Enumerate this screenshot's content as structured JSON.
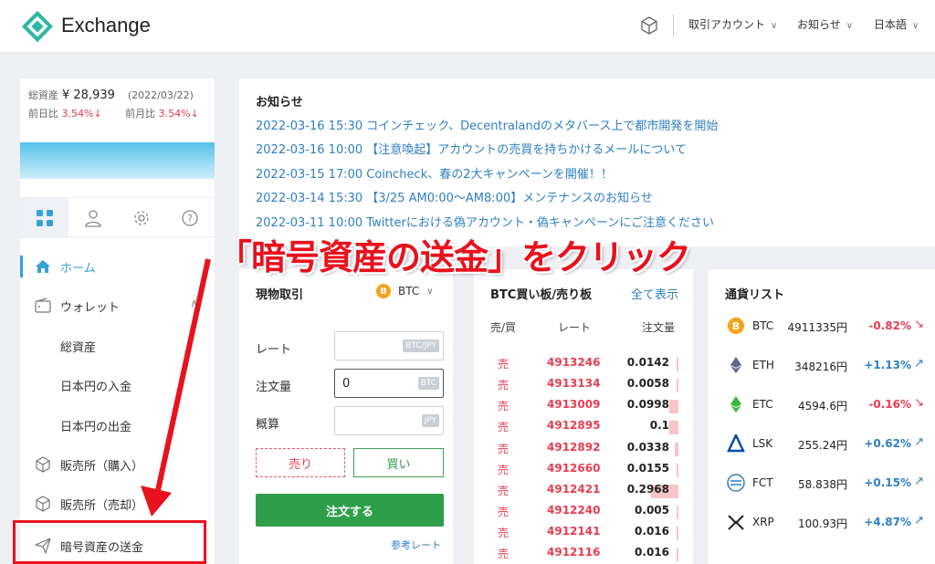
{
  "header": {
    "brand": "Exchange",
    "menu": [
      {
        "label": "取引アカウント"
      },
      {
        "label": "お知らせ"
      },
      {
        "label": "日本語"
      }
    ]
  },
  "sidebar": {
    "assets": {
      "label": "総資産",
      "value": "¥ 28,939",
      "date": "(2022/03/22)"
    },
    "changes": [
      {
        "label": "前日比",
        "value": "3.54%↓"
      },
      {
        "label": "前月比",
        "value": "3.54%↓"
      }
    ],
    "tabs": [
      {
        "icon": "grid-icon"
      },
      {
        "icon": "user-icon"
      },
      {
        "icon": "gear-icon"
      },
      {
        "icon": "help-icon"
      }
    ],
    "nav": [
      {
        "label": "ホーム",
        "icon": "home-icon",
        "active": true
      },
      {
        "label": "ウォレット",
        "icon": "wallet-icon"
      },
      {
        "label": "総資産"
      },
      {
        "label": "日本円の入金"
      },
      {
        "label": "日本円の出金"
      },
      {
        "label": "販売所（購入）",
        "icon": "box-icon"
      },
      {
        "label": "販売所（売却）",
        "icon": "box-icon"
      },
      {
        "label": "暗号資産の送金",
        "icon": "send-icon"
      }
    ]
  },
  "annotation": {
    "text": "「暗号資産の送金」をクリック",
    "color": "#e8121e"
  },
  "notices": {
    "title": "お知らせ",
    "items": [
      "2022-03-16 15:30 コインチェック、Decentralandのメタバース上で都市開発を開始",
      "2022-03-16 10:00 【注意喚起】アカウントの売買を持ちかけるメールについて",
      "2022-03-15 17:00 Coincheck、春の2大キャンペーンを開催！！",
      "2022-03-14 15:30 【3/25 AM0:00〜AM8:00】メンテナンスのお知らせ",
      "2022-03-11 10:00 Twitterにおける偽アカウント・偽キャンペーンにご注意ください"
    ]
  },
  "trade": {
    "title": "現物取引",
    "coin": "BTC",
    "coin_glyph": "B",
    "rate_label": "レート",
    "rate_unit": "BTC/JPY",
    "qty_label": "注文量",
    "qty_value": "0",
    "qty_unit": "BTC",
    "est_label": "概算",
    "est_unit": "JPY",
    "sell": "売り",
    "buy": "買い",
    "order": "注文する",
    "ref": "参考レート"
  },
  "book": {
    "title": "BTC買い板/売り板",
    "all": "全て表示",
    "headers": [
      "売/買",
      "レート",
      "注文量"
    ],
    "rows": [
      {
        "side": "売",
        "rate": "4913246",
        "qty": "0.0142",
        "fill": 0.03
      },
      {
        "side": "売",
        "rate": "4913134",
        "qty": "0.0058",
        "fill": 0.02
      },
      {
        "side": "売",
        "rate": "4913009",
        "qty": "0.0998",
        "fill": 0.2
      },
      {
        "side": "売",
        "rate": "4912895",
        "qty": "0.1",
        "fill": 0.2
      },
      {
        "side": "売",
        "rate": "4912892",
        "qty": "0.0338",
        "fill": 0.07
      },
      {
        "side": "売",
        "rate": "4912660",
        "qty": "0.0155",
        "fill": 0.03
      },
      {
        "side": "売",
        "rate": "4912421",
        "qty": "0.2968",
        "fill": 0.6
      },
      {
        "side": "売",
        "rate": "4912240",
        "qty": "0.005",
        "fill": 0.01
      },
      {
        "side": "売",
        "rate": "4912141",
        "qty": "0.016",
        "fill": 0.03
      },
      {
        "side": "売",
        "rate": "4912116",
        "qty": "0.016",
        "fill": 0.03
      }
    ]
  },
  "currencies": {
    "title": "通貨リスト",
    "rows": [
      {
        "sym": "BTC",
        "price": "4911335円",
        "chg": "-0.82%",
        "dir": "neg",
        "icon": "btc-icon",
        "color": "#f7a21a"
      },
      {
        "sym": "ETH",
        "price": "348216円",
        "chg": "+1.13%",
        "dir": "pos",
        "icon": "eth-icon",
        "color": "#62688f"
      },
      {
        "sym": "ETC",
        "price": "4594.6円",
        "chg": "-0.16%",
        "dir": "neg",
        "icon": "etc-icon",
        "color": "#3ab83a"
      },
      {
        "sym": "LSK",
        "price": "255.24円",
        "chg": "+0.62%",
        "dir": "pos",
        "icon": "lsk-icon",
        "color": "#0d4ea0"
      },
      {
        "sym": "FCT",
        "price": "58.838円",
        "chg": "+0.15%",
        "dir": "pos",
        "icon": "fct-icon",
        "color": "#2f7fc1"
      },
      {
        "sym": "XRP",
        "price": "100.93円",
        "chg": "+4.87%",
        "dir": "pos",
        "icon": "xrp-icon",
        "color": "#222222"
      }
    ]
  }
}
